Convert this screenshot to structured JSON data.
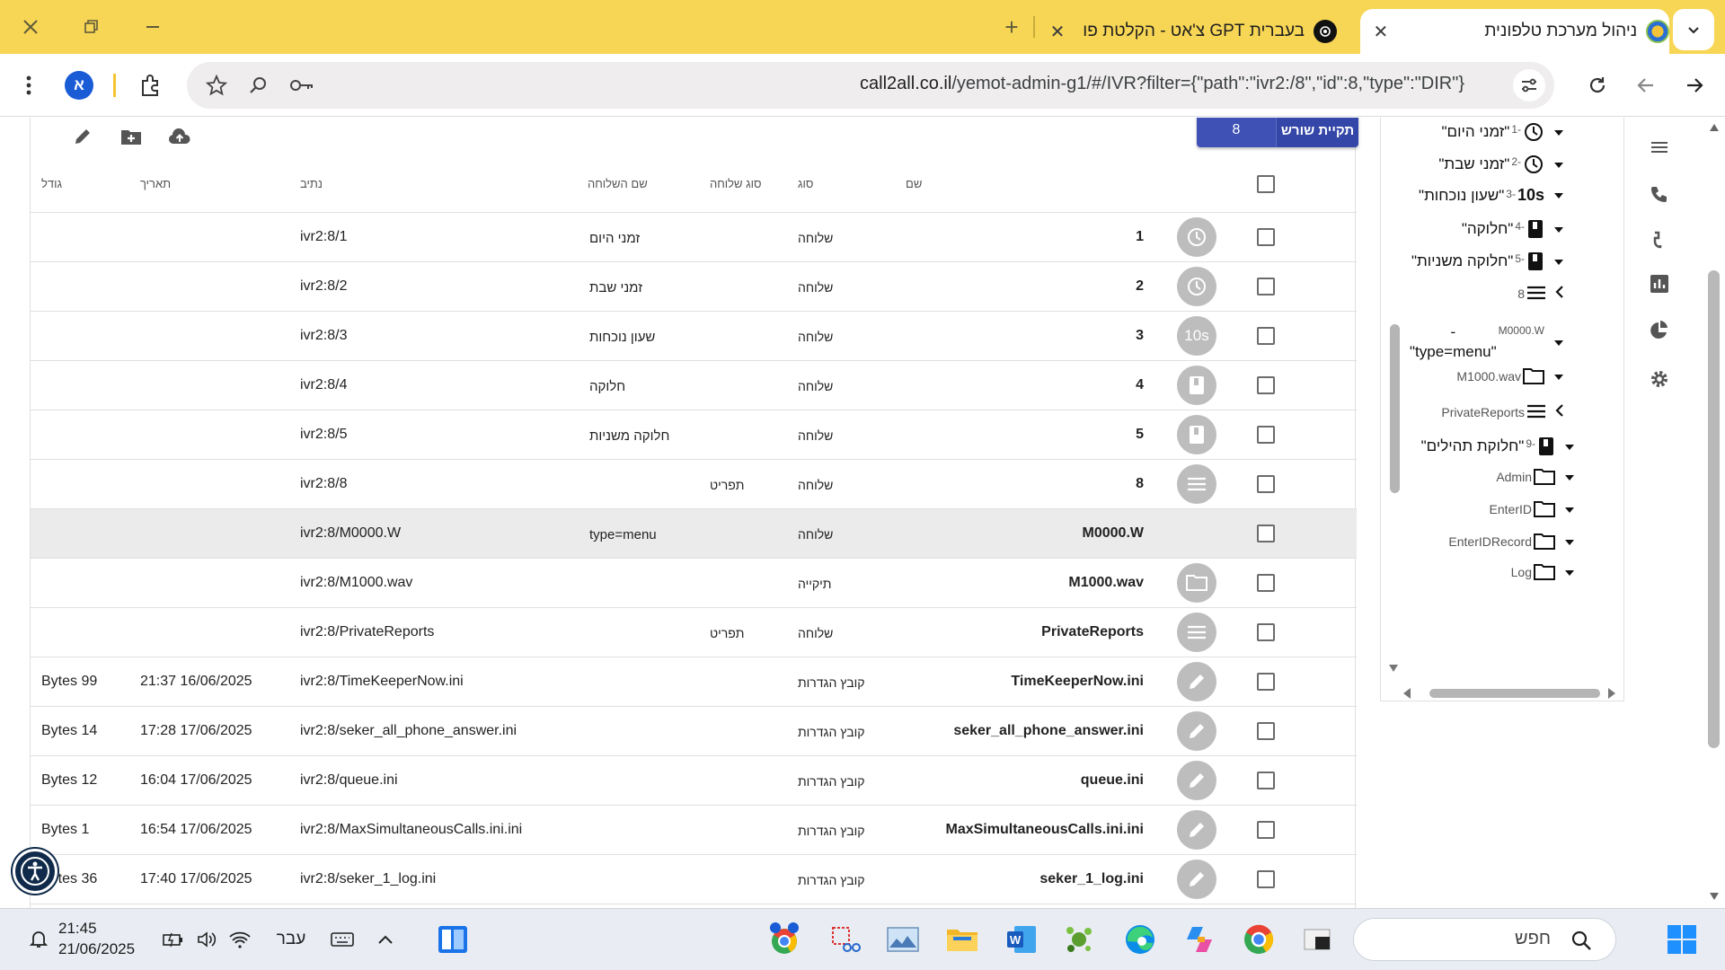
{
  "browser": {
    "tabs": [
      {
        "title": "ניהול מערכת טלפונית",
        "active": true
      },
      {
        "title": "בעברית GPT צ'אט - הקלטת פו",
        "active": false
      }
    ],
    "url_host": "call2all.co.il",
    "url_path": "/yemot-admin-g1/#/IVR?filter={\"path\":\"ivr2:/8\",\"id\":8,\"type\":\"DIR\"}",
    "profile_letter": "א"
  },
  "toolbar": {
    "root_button_label": "תקיית שורש",
    "root_button_count": "8"
  },
  "table": {
    "headers": {
      "size": "גודל",
      "date": "תאריך",
      "path": "נתיב",
      "ext_name": "שם השלוחה",
      "ext_type": "סוג שלוחה",
      "type": "סוג",
      "name": "שם"
    },
    "rows": [
      {
        "icon": "clock-icon",
        "name": "1",
        "type": "שלוחה",
        "ext_type": "",
        "ext_name": "זמני היום",
        "path": "ivr2:8/1",
        "date": "",
        "size": "",
        "selected": false
      },
      {
        "icon": "clock-icon",
        "name": "2",
        "type": "שלוחה",
        "ext_type": "",
        "ext_name": "זמני שבת",
        "path": "ivr2:8/2",
        "date": "",
        "size": "",
        "selected": false
      },
      {
        "icon": "timer-10s-icon",
        "name": "3",
        "type": "שלוחה",
        "ext_type": "",
        "ext_name": "שעון נוכחות",
        "path": "ivr2:8/3",
        "date": "",
        "size": "",
        "selected": false
      },
      {
        "icon": "book-icon",
        "name": "4",
        "type": "שלוחה",
        "ext_type": "",
        "ext_name": "חלוקה",
        "path": "ivr2:8/4",
        "date": "",
        "size": "",
        "selected": false
      },
      {
        "icon": "book-icon",
        "name": "5",
        "type": "שלוחה",
        "ext_type": "",
        "ext_name": "חלוקה משניות",
        "path": "ivr2:8/5",
        "date": "",
        "size": "",
        "selected": false
      },
      {
        "icon": "menu-icon",
        "name": "8",
        "type": "שלוחה",
        "ext_type": "תפריט",
        "ext_name": "",
        "path": "ivr2:8/8",
        "date": "",
        "size": "",
        "selected": false
      },
      {
        "icon": "",
        "name": "M0000.W",
        "type": "שלוחה",
        "ext_type": "",
        "ext_name": "type=menu",
        "path": "ivr2:8/M0000.W",
        "date": "",
        "size": "",
        "selected": true
      },
      {
        "icon": "folder-icon",
        "name": "M1000.wav",
        "type": "תיקייה",
        "ext_type": "",
        "ext_name": "",
        "path": "ivr2:8/M1000.wav",
        "date": "",
        "size": "",
        "selected": false
      },
      {
        "icon": "menu-icon",
        "name": "PrivateReports",
        "type": "שלוחה",
        "ext_type": "תפריט",
        "ext_name": "",
        "path": "ivr2:8/PrivateReports",
        "date": "",
        "size": "",
        "selected": false
      },
      {
        "icon": "pencil-icon",
        "name": "TimeKeeperNow.ini",
        "type": "קובץ הגדרות",
        "ext_type": "",
        "ext_name": "",
        "path": "ivr2:8/TimeKeeperNow.ini",
        "date": "21:37 16/06/2025",
        "size": "Bytes 99",
        "selected": false
      },
      {
        "icon": "pencil-icon",
        "name": "seker_all_phone_answer.ini",
        "type": "קובץ הגדרות",
        "ext_type": "",
        "ext_name": "",
        "path": "ivr2:8/seker_all_phone_answer.ini",
        "date": "17:28 17/06/2025",
        "size": "Bytes 14",
        "selected": false
      },
      {
        "icon": "pencil-icon",
        "name": "queue.ini",
        "type": "קובץ הגדרות",
        "ext_type": "",
        "ext_name": "",
        "path": "ivr2:8/queue.ini",
        "date": "16:04 17/06/2025",
        "size": "Bytes 12",
        "selected": false
      },
      {
        "icon": "pencil-icon",
        "name": "MaxSimultaneousCalls.ini.ini",
        "type": "קובץ הגדרות",
        "ext_type": "",
        "ext_name": "",
        "path": "ivr2:8/MaxSimultaneousCalls.ini.ini",
        "date": "16:54 17/06/2025",
        "size": "Bytes 1",
        "selected": false
      },
      {
        "icon": "pencil-icon",
        "name": "seker_1_log.ini",
        "type": "קובץ הגדרות",
        "ext_type": "",
        "ext_name": "",
        "path": "ivr2:8/seker_1_log.ini",
        "date": "17:40 17/06/2025",
        "size": "Bytes 36",
        "selected": false
      }
    ]
  },
  "tree": {
    "nodes": [
      {
        "main": "\"זמני היום\"",
        "small": "1-",
        "icon": "clock-icon",
        "caret": "down"
      },
      {
        "main": "\"זמני שבת\"",
        "small": "2-",
        "icon": "clock-icon",
        "caret": "down"
      },
      {
        "main": "\"שעון נוכחות\"",
        "small": "3-",
        "icon_text": "10s",
        "icon": "timer-10s-icon",
        "caret": "down"
      },
      {
        "main": "\"חלוקה\"",
        "small": "4-",
        "icon": "book-icon",
        "caret": "down"
      },
      {
        "main": "\"חלוקה משניות\"",
        "small": "5-",
        "icon": "book-icon",
        "caret": "down"
      },
      {
        "main": "",
        "small": "8",
        "icon": "menu-icon",
        "caret": "left"
      },
      {
        "main": "-\n\"type=menu\"",
        "small": "M0000.W",
        "icon": "",
        "caret": "down"
      },
      {
        "main": "",
        "small": "M1000.wav",
        "icon": "folder-icon",
        "caret": "down"
      },
      {
        "main": "",
        "small": "PrivateReports",
        "icon": "menu-icon",
        "caret": "left"
      },
      {
        "main": "\"חלוקת תהילים\"",
        "small": "9-",
        "icon": "book-icon",
        "caret": "down"
      },
      {
        "main": "",
        "small": "Admin",
        "icon": "folder-icon",
        "caret": "down"
      },
      {
        "main": "",
        "small": "EnterID",
        "icon": "folder-icon",
        "caret": "down"
      },
      {
        "main": "",
        "small": "EnterIDRecord",
        "icon": "folder-icon",
        "caret": "down"
      },
      {
        "main": "",
        "small": "Log",
        "icon": "folder-icon",
        "caret": "down"
      }
    ]
  },
  "taskbar": {
    "time": "21:45",
    "date": "21/06/2025",
    "language": "עבר",
    "search_placeholder": "חפש"
  }
}
